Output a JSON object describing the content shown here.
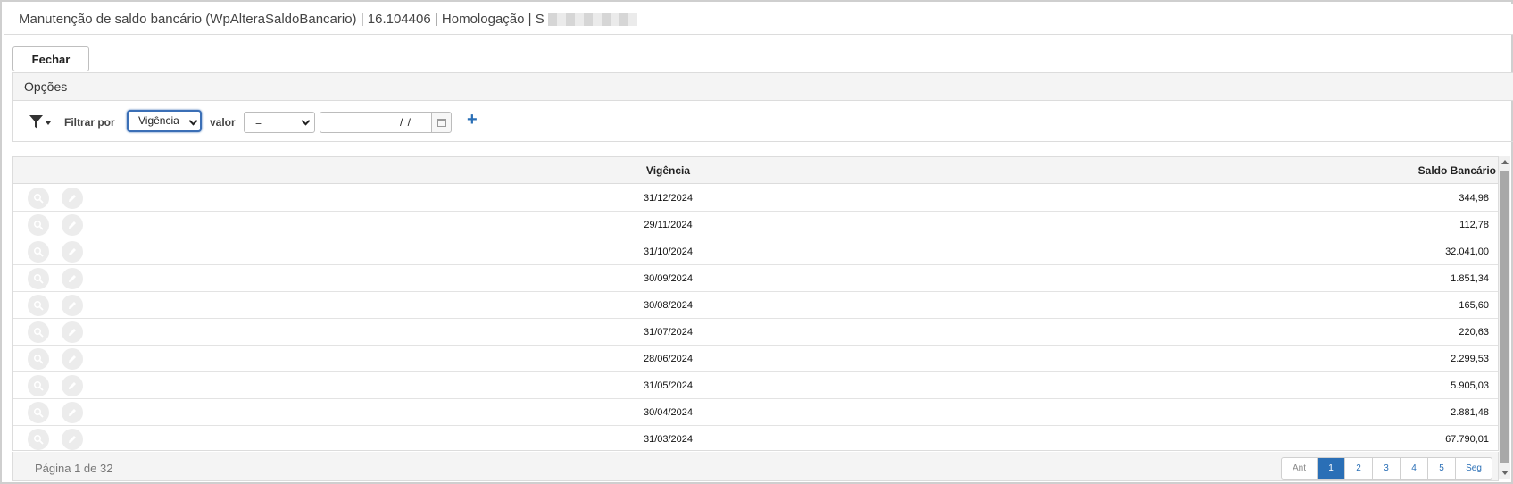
{
  "window": {
    "title": "Manutenção de saldo bancário (WpAlteraSaldoBancario) | 16.104406 | Homologação | S"
  },
  "toolbar": {
    "close_label": "Fechar"
  },
  "options": {
    "title": "Opções",
    "filter_label": "Filtrar por",
    "filter_field_value": "Vigência",
    "valor_label": "valor",
    "operator_value": "=",
    "date_value": "/ /",
    "add_label": "+"
  },
  "table": {
    "columns": [
      "Vigência",
      "Saldo Bancário"
    ],
    "rows": [
      {
        "vigencia": "31/12/2024",
        "saldo": "344,98"
      },
      {
        "vigencia": "29/11/2024",
        "saldo": "112,78"
      },
      {
        "vigencia": "31/10/2024",
        "saldo": "32.041,00"
      },
      {
        "vigencia": "30/09/2024",
        "saldo": "1.851,34"
      },
      {
        "vigencia": "30/08/2024",
        "saldo": "165,60"
      },
      {
        "vigencia": "31/07/2024",
        "saldo": "220,63"
      },
      {
        "vigencia": "28/06/2024",
        "saldo": "2.299,53"
      },
      {
        "vigencia": "31/05/2024",
        "saldo": "5.905,03"
      },
      {
        "vigencia": "30/04/2024",
        "saldo": "2.881,48"
      },
      {
        "vigencia": "31/03/2024",
        "saldo": "67.790,01"
      }
    ]
  },
  "pagination": {
    "info": "Página 1 de 32",
    "prev_label": "Ant",
    "pages": [
      "1",
      "2",
      "3",
      "4",
      "5"
    ],
    "active_page": "1",
    "next_label": "Seg"
  },
  "icons": {
    "filter": "filter-icon",
    "view": "magnifier-icon",
    "edit": "pencil-icon",
    "calendar": "calendar-icon"
  },
  "colors": {
    "accent": "#2a6fb6",
    "header_bg": "#f4f4f4",
    "border": "#dcdcdc"
  }
}
